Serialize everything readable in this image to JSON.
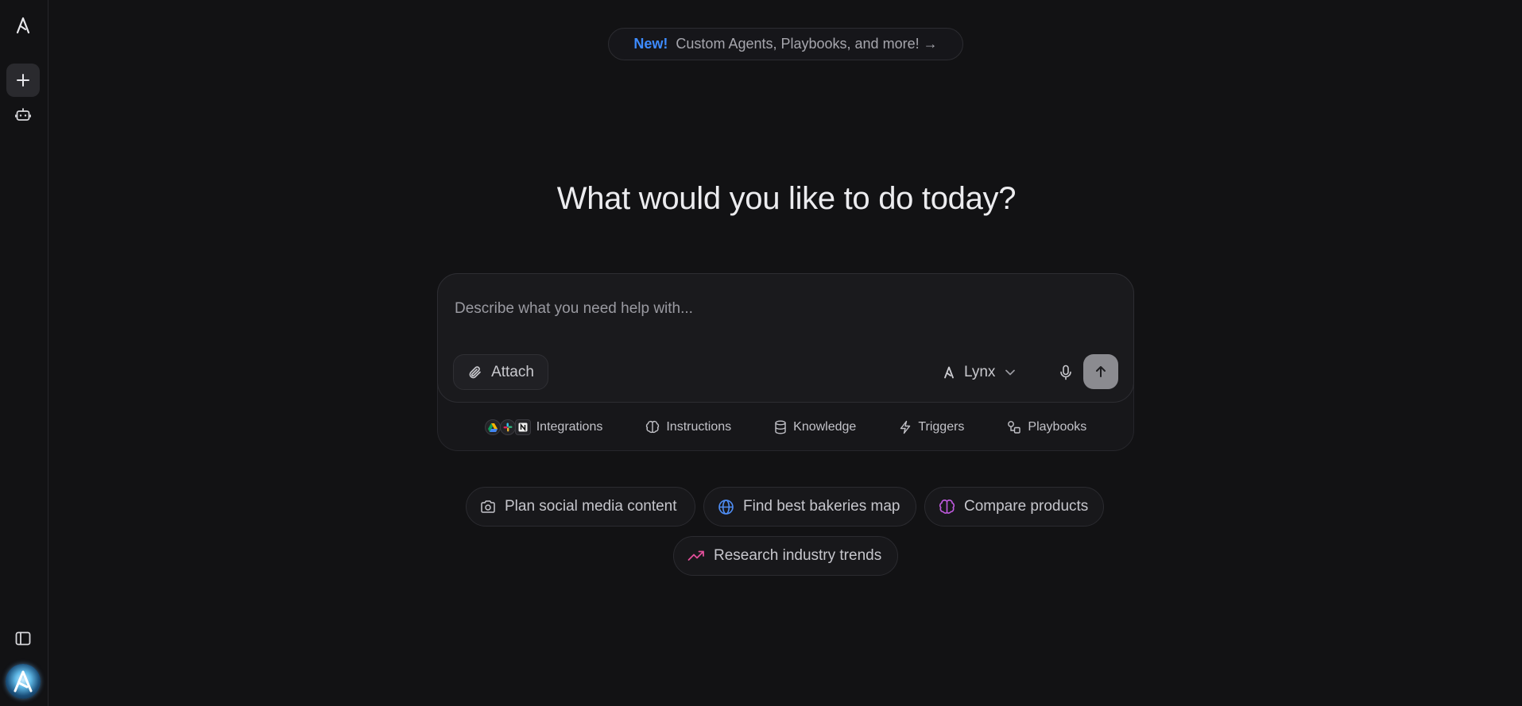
{
  "banner": {
    "tag": "New!",
    "text": "Custom Agents, Playbooks, and more! →"
  },
  "heading": "What would you like to do today?",
  "composer": {
    "placeholder": "Describe what you need help with...",
    "attach_label": "Attach",
    "model_label": "Lynx"
  },
  "toolbar": {
    "integrations": "Integrations",
    "instructions": "Instructions",
    "knowledge": "Knowledge",
    "triggers": "Triggers",
    "playbooks": "Playbooks"
  },
  "suggestions": [
    {
      "label": "Plan social media content",
      "icon": "camera-icon"
    },
    {
      "label": "Find best bakeries map",
      "icon": "globe-icon",
      "color": "#4f8ef5"
    },
    {
      "label": "Compare products",
      "icon": "brain-icon",
      "color": "#c05ae0"
    },
    {
      "label": "Research industry trends",
      "icon": "trending-up-icon",
      "color": "#e24f9a"
    }
  ],
  "colors": {
    "background": "#121214",
    "accent_new": "#3d8bff",
    "send_button": "#8b8b90"
  }
}
